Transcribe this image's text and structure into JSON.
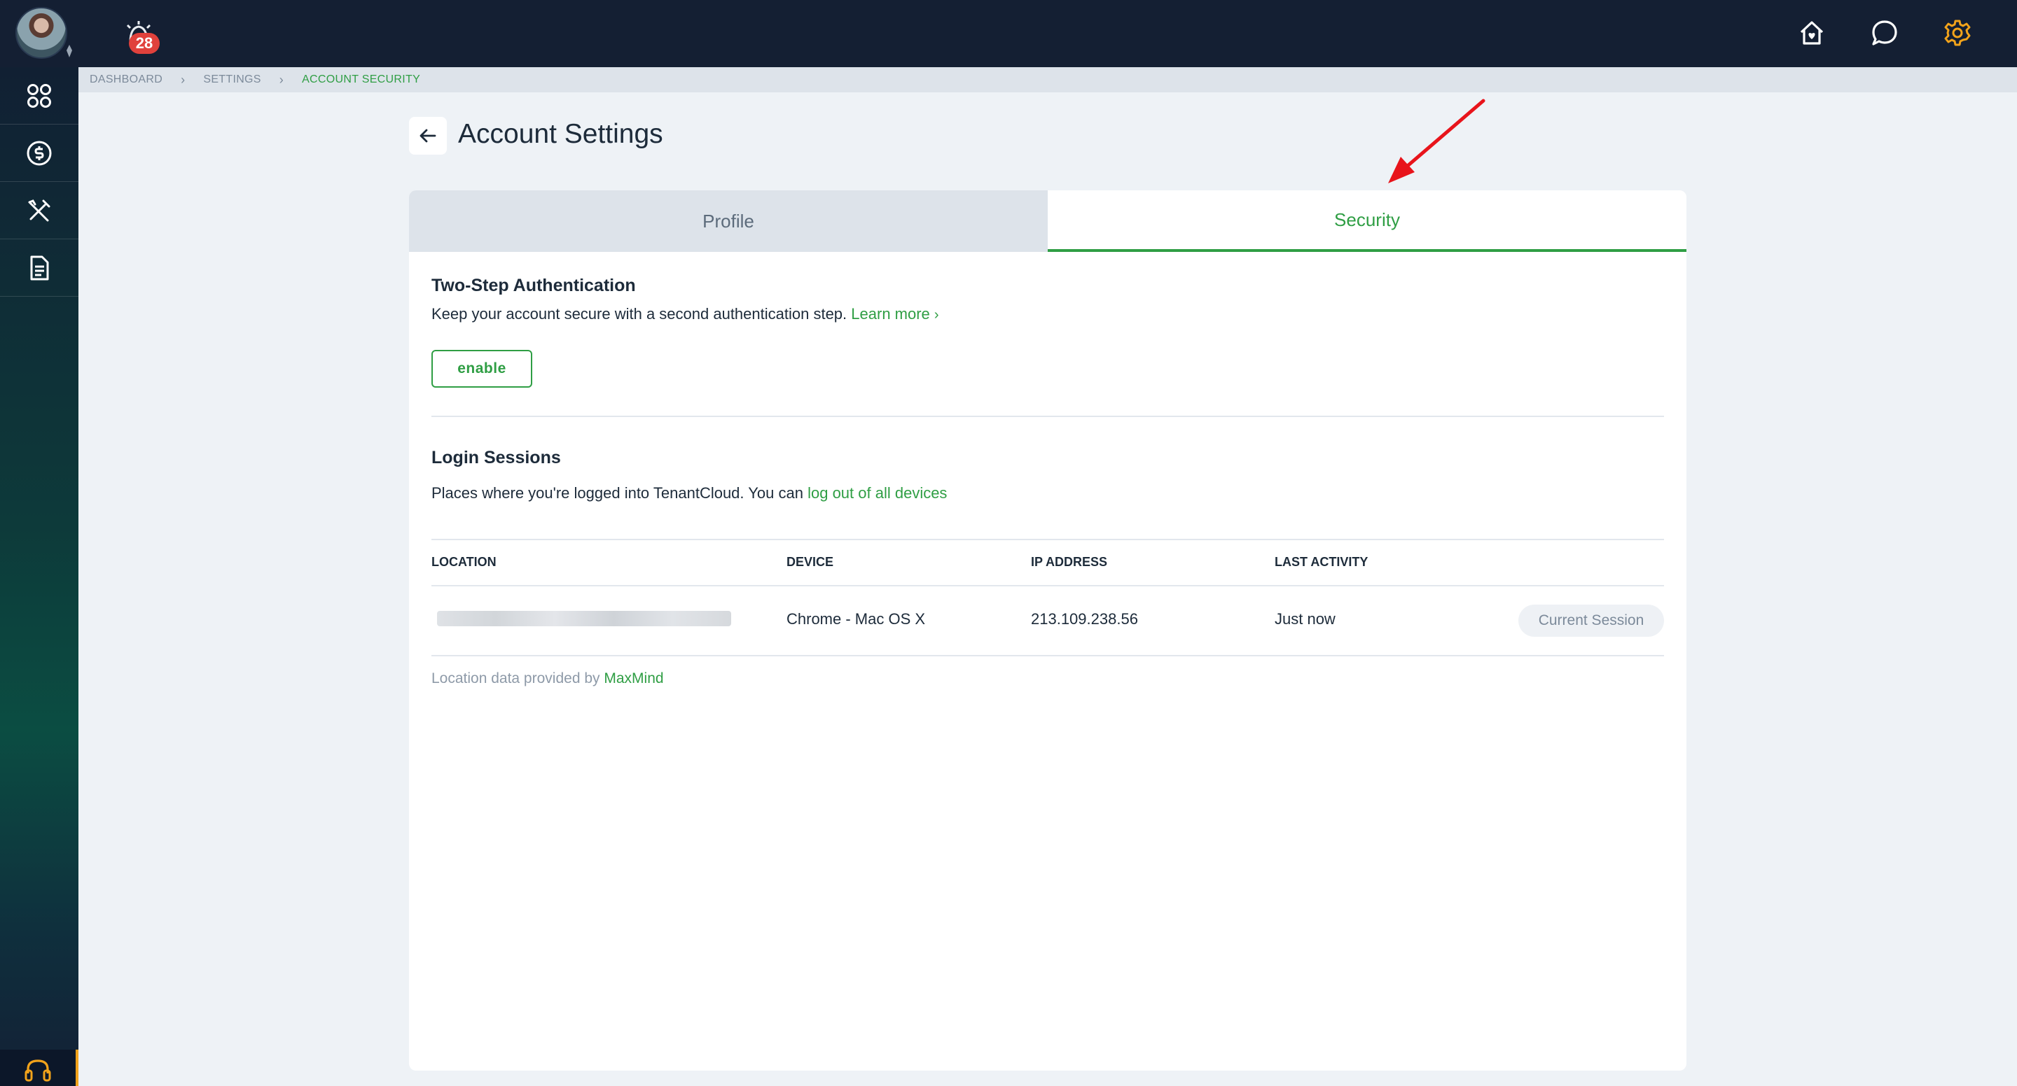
{
  "topbar": {
    "notification_count": "28",
    "icons": [
      "avatar",
      "notification-bell-icon",
      "home-heart-icon",
      "chat-bubble-icon",
      "gear-icon"
    ],
    "accent": "#f2a31b"
  },
  "sidebar": {
    "items": [
      "apps-grid-icon",
      "dollar-circle-icon",
      "tools-icon",
      "document-icon"
    ],
    "support_icon": "headset-icon"
  },
  "breadcrumb": [
    "DASHBOARD",
    "SETTINGS",
    "ACCOUNT SECURITY"
  ],
  "page": {
    "title": "Account Settings"
  },
  "tabs": {
    "profile": "Profile",
    "security": "Security",
    "active": "Security"
  },
  "two_step": {
    "title": "Two-Step Authentication",
    "description": "Keep your account secure with a second authentication step.",
    "learn_more": "Learn more",
    "button": "enable"
  },
  "login_sessions": {
    "title": "Login Sessions",
    "description": "Places where you're logged into TenantCloud. You can",
    "logout_link": "log out of all devices",
    "columns": [
      "LOCATION",
      "DEVICE",
      "IP ADDRESS",
      "LAST ACTIVITY"
    ],
    "rows": [
      {
        "location": "",
        "device": "Chrome - Mac OS X",
        "ip": "213.109.238.56",
        "last_activity": "Just now",
        "status": "Current Session"
      }
    ],
    "footnote": "Location data provided by",
    "footnote_link": "MaxMind"
  },
  "colors": {
    "brand_green": "#2f9e44",
    "topbar": "#141f33",
    "badge": "#e0413c",
    "annotation_arrow": "#e8141b"
  }
}
